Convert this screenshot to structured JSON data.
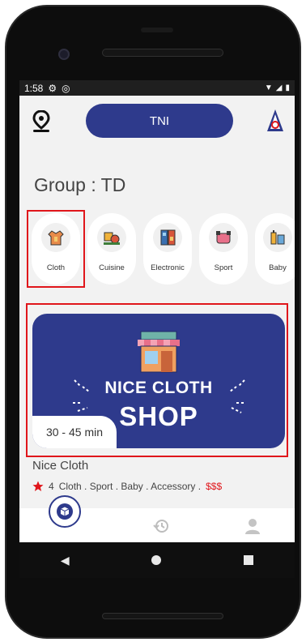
{
  "status_bar": {
    "time": "1:58"
  },
  "header": {
    "center_button": "TNI"
  },
  "group": {
    "title": "Group : TD"
  },
  "categories": [
    {
      "label": "Cloth",
      "selected": true
    },
    {
      "label": "Cuisine"
    },
    {
      "label": "Electronic"
    },
    {
      "label": "Sport"
    },
    {
      "label": "Baby"
    }
  ],
  "shop": {
    "banner_line1": "NICE CLOTH",
    "banner_line2": "SHOP",
    "delivery_time": "30 - 45 min",
    "name": "Nice Cloth",
    "rating": "4",
    "tags": "Cloth . Sport . Baby . Accessory .",
    "price": "$$$"
  },
  "colors": {
    "primary": "#2e3a8c",
    "highlight_border": "#e0161b",
    "price": "#e0161b",
    "background": "#f2f2f2"
  }
}
